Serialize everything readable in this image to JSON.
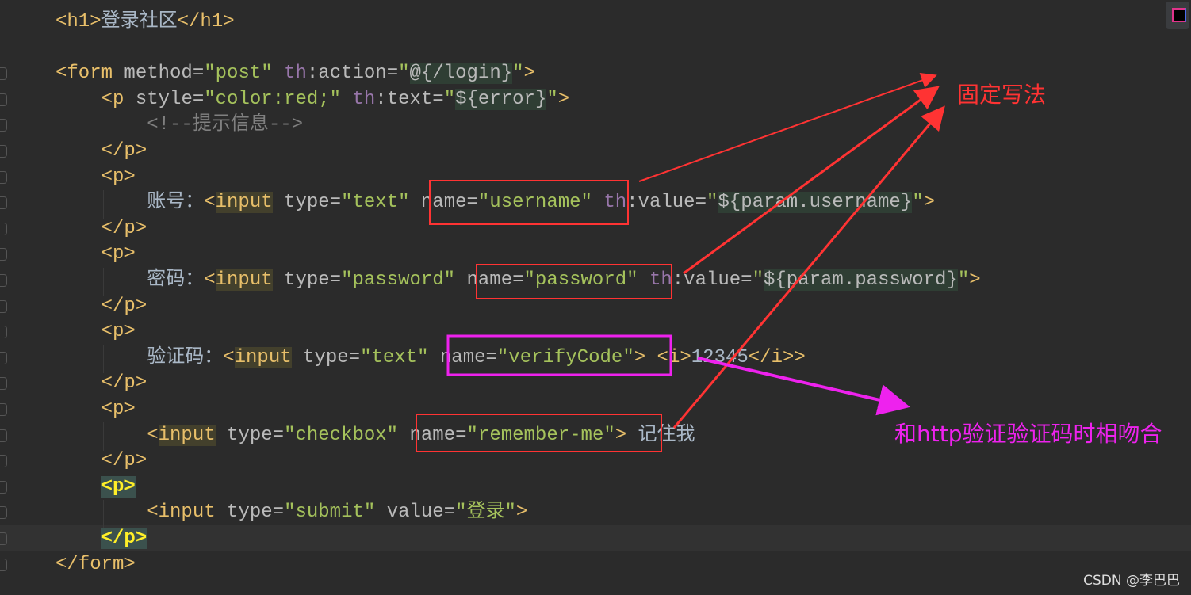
{
  "code_lines": [
    [
      [
        "tag",
        "<h1>"
      ],
      [
        "txt",
        "登录社区"
      ],
      [
        "tag",
        "</h1>"
      ]
    ],
    [],
    [
      [
        "tag",
        "<form "
      ],
      [
        "attr",
        "method="
      ],
      [
        "str",
        "\"post\" "
      ],
      [
        "th",
        "th"
      ],
      [
        "attr",
        ":action="
      ],
      [
        "str",
        "\""
      ],
      [
        "hl-ex",
        "@{/login}"
      ],
      [
        "str",
        "\""
      ],
      [
        "tag",
        ">"
      ]
    ],
    [
      [
        "tag",
        "    <p "
      ],
      [
        "attr",
        "style="
      ],
      [
        "str",
        "\"color:red;\" "
      ],
      [
        "th",
        "th"
      ],
      [
        "attr",
        ":text="
      ],
      [
        "str",
        "\""
      ],
      [
        "hl-ex",
        "${error}"
      ],
      [
        "str",
        "\""
      ],
      [
        "tag",
        ">"
      ]
    ],
    [
      [
        "cm",
        "        <!--提示信息-->"
      ]
    ],
    [
      [
        "tag",
        "    </p>"
      ]
    ],
    [
      [
        "tag",
        "    <p>"
      ]
    ],
    [
      [
        "txt",
        "        账号："
      ],
      [
        "tag",
        "<"
      ],
      [
        "tag hl-in",
        "input"
      ],
      [
        "attr",
        " type="
      ],
      [
        "str",
        "\"text\" "
      ],
      [
        "attr",
        "name="
      ],
      [
        "str",
        "\"username\" "
      ],
      [
        "th",
        "th"
      ],
      [
        "attr",
        ":value="
      ],
      [
        "str",
        "\""
      ],
      [
        "hl-ex",
        "${param.username}"
      ],
      [
        "str",
        "\""
      ],
      [
        "tag",
        ">"
      ]
    ],
    [
      [
        "tag",
        "    </p>"
      ]
    ],
    [
      [
        "tag",
        "    <p>"
      ]
    ],
    [
      [
        "txt",
        "        密码："
      ],
      [
        "tag",
        "<"
      ],
      [
        "tag hl-in",
        "input"
      ],
      [
        "attr",
        " type="
      ],
      [
        "str",
        "\"password\" "
      ],
      [
        "attr",
        "name="
      ],
      [
        "str",
        "\"password\" "
      ],
      [
        "th",
        "th"
      ],
      [
        "attr",
        ":value="
      ],
      [
        "str",
        "\""
      ],
      [
        "hl-ex",
        "${param.password}"
      ],
      [
        "str",
        "\""
      ],
      [
        "tag",
        ">"
      ]
    ],
    [
      [
        "tag",
        "    </p>"
      ]
    ],
    [
      [
        "tag",
        "    <p>"
      ]
    ],
    [
      [
        "txt",
        "        验证码："
      ],
      [
        "tag",
        "<"
      ],
      [
        "tag hl-in",
        "input"
      ],
      [
        "attr",
        " type="
      ],
      [
        "str",
        "\"text\" "
      ],
      [
        "attr",
        "name="
      ],
      [
        "str",
        "\"verifyCode\""
      ],
      [
        "tag",
        ">"
      ],
      [
        "txt",
        " "
      ],
      [
        "tag",
        "<i>"
      ],
      [
        "txt",
        "12345"
      ],
      [
        "tag",
        "</i>"
      ],
      [
        "tag",
        ">"
      ]
    ],
    [
      [
        "tag",
        "    </p>"
      ]
    ],
    [
      [
        "tag",
        "    <p>"
      ]
    ],
    [
      [
        "tag",
        "        <"
      ],
      [
        "tag hl-in",
        "input"
      ],
      [
        "attr",
        " type="
      ],
      [
        "str",
        "\"checkbox\" "
      ],
      [
        "attr",
        "name="
      ],
      [
        "str",
        "\"remember-me\""
      ],
      [
        "tag",
        ">"
      ],
      [
        "txt",
        " 记住我"
      ]
    ],
    [
      [
        "tag",
        "    </p>"
      ]
    ],
    [
      [
        "txt",
        "    "
      ],
      [
        "hl-p",
        "<p>"
      ]
    ],
    [
      [
        "tag",
        "        <input "
      ],
      [
        "attr",
        "type="
      ],
      [
        "str",
        "\"submit\" "
      ],
      [
        "attr",
        "value="
      ],
      [
        "str",
        "\"登录\""
      ],
      [
        "tag",
        ">"
      ]
    ],
    [
      [
        "txt",
        "    "
      ],
      [
        "hl-p",
        "</p>"
      ]
    ],
    [
      [
        "tag",
        "</form>"
      ]
    ]
  ],
  "annotations": {
    "fixed_syntax": "固定写法",
    "http_match": "和http验证验证码时相吻合",
    "red": "#ff3333",
    "magenta": "#ee22ee"
  },
  "watermark": "CSDN @李巴巴"
}
